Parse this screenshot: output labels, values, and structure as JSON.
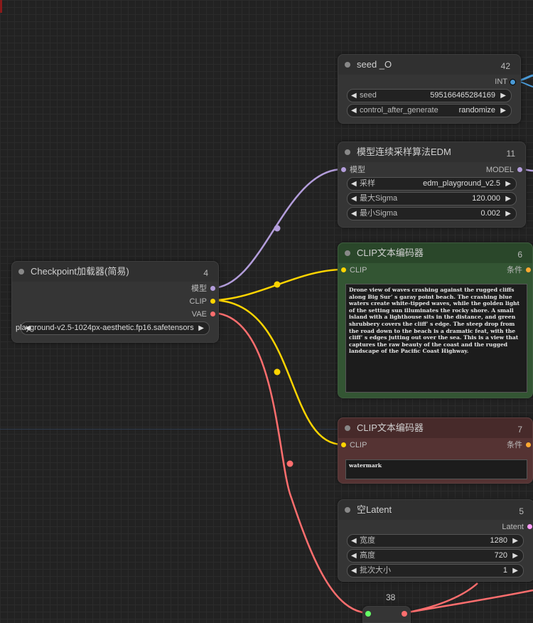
{
  "canvas": {
    "bg_color": "#222222",
    "grid_color": "#2b2b2b"
  },
  "colors": {
    "model_wire": "#b39ddb",
    "clip_wire": "#ffd500",
    "vae_wire": "#ff6e6e",
    "int_wire": "#4a9ad6",
    "latent_wire": "#ff9cf9",
    "clip_node_green": "#335533",
    "clip_node_red": "#553333"
  },
  "nodes": {
    "seed": {
      "title": "seed _O",
      "id": "42",
      "output_label": "INT",
      "widgets": [
        {
          "label": "seed",
          "value": "595166465284169"
        },
        {
          "label": "control_after_generate",
          "value": "randomize"
        }
      ]
    },
    "edm": {
      "title": "模型连续采样算法EDM",
      "id": "11",
      "input_label": "模型",
      "output_label": "MODEL",
      "widgets": [
        {
          "label": "采样",
          "value": "edm_playground_v2.5"
        },
        {
          "label": "最大Sigma",
          "value": "120.000"
        },
        {
          "label": "最小Sigma",
          "value": "0.002"
        }
      ]
    },
    "clip_pos": {
      "title": "CLIP文本编码器",
      "id": "6",
      "input_label": "CLIP",
      "output_label": "条件",
      "text": "Drone view of waves crashing against the rugged cliffs along Big Sur’ s garay point beach. The crashing blue waters create white-tipped waves, while the golden light of the setting sun illuminates the rocky shore. A small island with a lighthouse sits in the distance, and green shrubbery covers the cliff’ s edge. The steep drop from the road down to the beach is a dramatic feat, with the cliff’ s edges jutting out over the sea. This is a view that captures the raw beauty of the coast and the rugged landscape of the Pacific Coast Highway."
    },
    "clip_neg": {
      "title": "CLIP文本编码器",
      "id": "7",
      "input_label": "CLIP",
      "output_label": "条件",
      "text": "watermark"
    },
    "checkpoint": {
      "title": "Checkpoint加载器(简易)",
      "id": "4",
      "outputs": [
        "模型",
        "CLIP",
        "VAE"
      ],
      "widget_value": "playground-v2.5-1024px-aesthetic.fp16.safetensors",
      "widget_label_overlap": "ckpt_name"
    },
    "latent": {
      "title": "空Latent",
      "id": "5",
      "output_label": "Latent",
      "widgets": [
        {
          "label": "宽度",
          "value": "1280"
        },
        {
          "label": "高度",
          "value": "720"
        },
        {
          "label": "批次大小",
          "value": "1"
        }
      ]
    },
    "reroute": {
      "id": "38"
    }
  }
}
